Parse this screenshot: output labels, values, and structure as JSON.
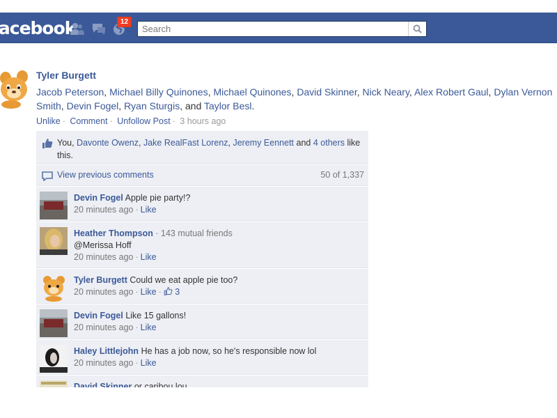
{
  "header": {
    "logo": "facebook",
    "notification_badge": "12",
    "search_placeholder": "Search",
    "bar_color": "#3b5998"
  },
  "story": {
    "author": "Tyler Burgett",
    "tagged": [
      "Jacob Peterson",
      "Michael Billy Quinones",
      "Michael Quinones",
      "David Skinner",
      "Nick Neary",
      "Alex Robert Gaul",
      "Dylan Vernon Smith",
      "Devin Fogel",
      "Ryan Sturgis"
    ],
    "last_tagged": "Taylor Besl",
    "sep": ", ",
    "and": ", and ",
    "end": ".",
    "actions": {
      "unlike": "Unlike",
      "comment": "Comment",
      "unfollow": "Unfollow Post",
      "time": "3 hours ago"
    }
  },
  "likes": {
    "you": "You, ",
    "names": [
      "Davonte Owenz",
      "Jake RealFast Lorenz",
      "Jeremy Eennett"
    ],
    "sep1": ", ",
    "and": " and ",
    "others_link": "4 others",
    "suffix": " like this."
  },
  "previous": {
    "label": "View previous comments",
    "count": "50 of 1,337"
  },
  "comments": [
    {
      "name": "Devin Fogel",
      "mutual": "",
      "text": "Apple pie party!?",
      "time": "20 minutes ago",
      "like": "Like",
      "likes": ""
    },
    {
      "name": "Heather Thompson",
      "mutual": "143 mutual friends",
      "text": "@Merissa Hoff",
      "time": "20 minutes ago",
      "like": "Like",
      "likes": ""
    },
    {
      "name": "Tyler Burgett",
      "mutual": "",
      "text": "Could we eat apple pie too?",
      "time": "20 minutes ago",
      "like": "Like",
      "likes": "3"
    },
    {
      "name": "Devin Fogel",
      "mutual": "",
      "text": "Like 15 gallons!",
      "time": "20 minutes ago",
      "like": "Like",
      "likes": ""
    },
    {
      "name": "Haley Littlejohn",
      "mutual": "",
      "text": "He has a job now, so he's responsible now lol",
      "time": "20 minutes ago",
      "like": "Like",
      "likes": ""
    },
    {
      "name": "David Skinner",
      "mutual": "",
      "text": "or caribou lou",
      "time": "",
      "like": "",
      "likes": ""
    }
  ],
  "colors": {
    "link": "#3b5998",
    "ufi_bg": "#edeff4",
    "badge": "#f03d25"
  }
}
